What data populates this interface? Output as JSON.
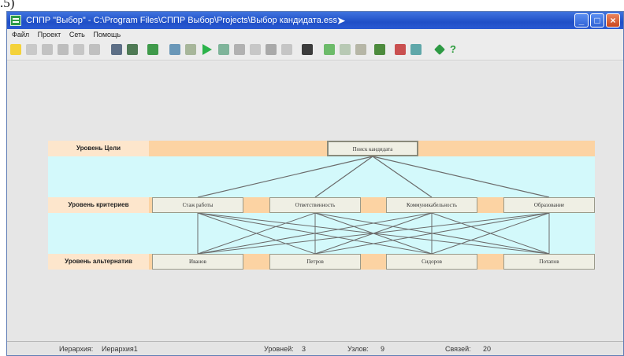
{
  "caption_crop": ".5)",
  "window": {
    "title": "СППР \"Выбор\" - C:\\Program Files\\СППР Выбор\\Projects\\Выбор кандидата.ess",
    "controls": {
      "minimize": "_",
      "maximize": "□",
      "close": "×"
    }
  },
  "menu": [
    "Файл",
    "Проект",
    "Сеть",
    "Помощь"
  ],
  "toolbar": {
    "icons": [
      "new-file-icon",
      "open-icon",
      "copy-icon",
      "save-icon",
      "print-icon",
      "cut-icon",
      "database-icon",
      "grid-icon",
      "export-icon",
      "network-icon",
      "flag-icon",
      "run-icon",
      "node-icon",
      "record-icon",
      "doc-icon",
      "chart-icon",
      "search-icon",
      "settings-icon",
      "add-icon",
      "table-icon",
      "filter-icon",
      "stack-icon",
      "weight-icon",
      "globe-icon",
      "diamond-icon",
      "help-icon"
    ],
    "help_label": "?"
  },
  "levels": {
    "goal_label": "Уровень Цели",
    "criteria_label": "Уровень критериев",
    "alternatives_label": "Уровень альтернатив"
  },
  "goal": "Поиск кандидата",
  "criteria": [
    "Стаж работы",
    "Ответственность",
    "Коммуникабельность",
    "Образование"
  ],
  "alternatives": [
    "Иванов",
    "Петров",
    "Сидоров",
    "Потапов"
  ],
  "status_bar": {
    "hierarchy_label": "Иерархия:",
    "hierarchy_value": "Иерархия1",
    "levels_label": "Уровней:",
    "levels_value": "3",
    "nodes_label": "Узлов:",
    "nodes_value": "9",
    "links_label": "Связей:",
    "links_value": "20"
  },
  "colors": {
    "title_bar": "#2a5ad2",
    "level_band": "#fcd3a3",
    "link_band": "#d3f9fb",
    "node_fill": "#efefe4",
    "link_line": "#6b6b6b"
  }
}
